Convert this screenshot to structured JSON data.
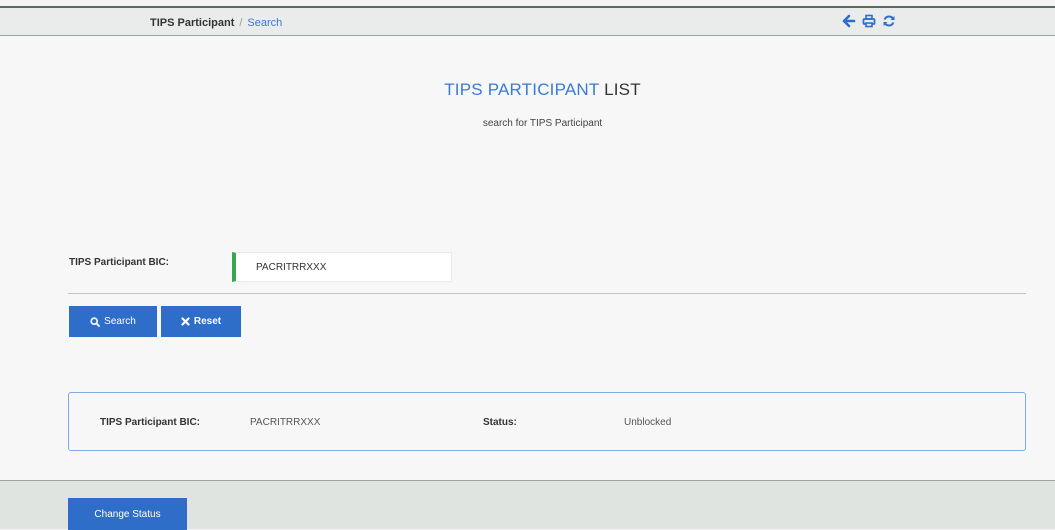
{
  "breadcrumb": {
    "current": "TIPS Participant",
    "separator": "/",
    "link": "Search"
  },
  "toolbar_icons": [
    "back-arrow-icon",
    "print-icon",
    "refresh-icon"
  ],
  "header": {
    "title_highlight": "TIPS PARTICIPANT",
    "title_rest": "LIST",
    "subtitle": "search for TIPS Participant"
  },
  "search_form": {
    "bic_label": "TIPS Participant BIC:",
    "bic_value": "PACRITRRXXX",
    "search_label": "Search",
    "reset_label": "Reset"
  },
  "result": {
    "bic_label": "TIPS Participant BIC:",
    "bic_value": "PACRITRRXXX",
    "status_label": "Status:",
    "status_value": "Unblocked"
  },
  "footer": {
    "change_status_label": "Change Status"
  },
  "colors": {
    "accent": "#2f6ec8",
    "link": "#3a7bd5",
    "input_valid_marker": "#36a64f"
  }
}
